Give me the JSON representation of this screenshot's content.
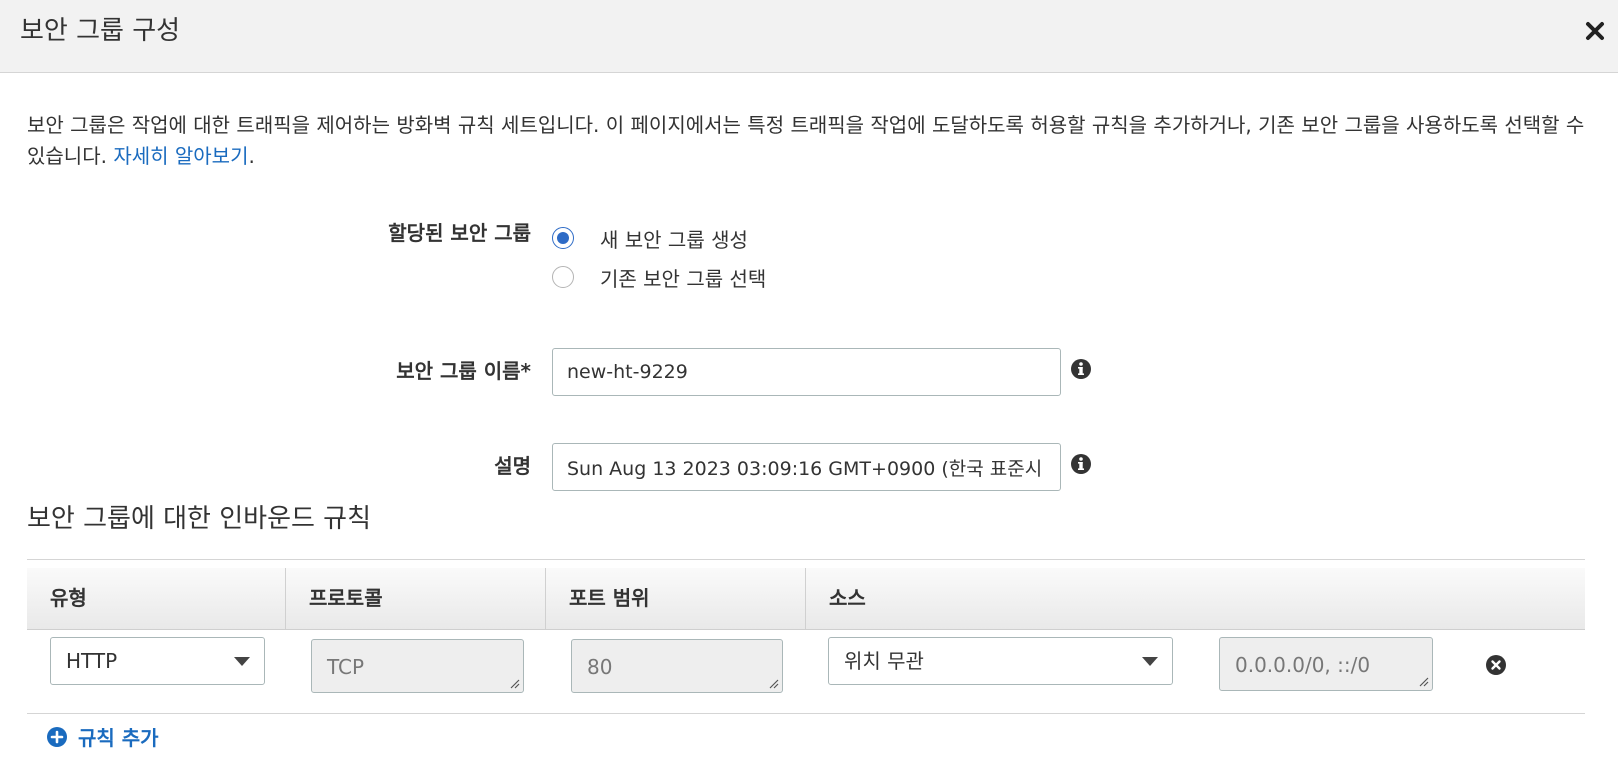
{
  "dialog": {
    "title": "보안 그룹 구성",
    "close_icon": "close-icon"
  },
  "intro": {
    "text": "보안 그룹은 작업에 대한 트래픽을 제어하는 방화벽 규칙 세트입니다. 이 페이지에서는 특정 트래픽을 작업에 도달하도록 허용할 규칙을 추가하거나, 기존 보안 그룹을 사용하도록 선택할 수 있습니다. ",
    "link": "자세히 알아보기",
    "after_link": "."
  },
  "assignment": {
    "label": "할당된 보안 그룹",
    "options": [
      {
        "label": "새 보안 그룹 생성",
        "selected": true
      },
      {
        "label": "기존 보안 그룹 선택",
        "selected": false
      }
    ]
  },
  "name_field": {
    "label": "보안 그룹 이름*",
    "value": "new-ht-9229"
  },
  "description_field": {
    "label": "설명",
    "value": "Sun Aug 13 2023 03:09:16 GMT+0900 (한국 표준시"
  },
  "inbound": {
    "title": "보안 그룹에 대한 인바운드 규칙",
    "columns": [
      "유형",
      "프로토콜",
      "포트 범위",
      "소스"
    ],
    "rows": [
      {
        "type": "HTTP",
        "protocol": "TCP",
        "port_range": "80",
        "source": "위치 무관",
        "cidr": "0.0.0.0/0, ::/0"
      }
    ],
    "add_rule": "규칙 추가"
  },
  "colors": {
    "accent": "#2e6bc6",
    "link": "#1a6bbf",
    "header_bg": "#f2f2f2"
  }
}
